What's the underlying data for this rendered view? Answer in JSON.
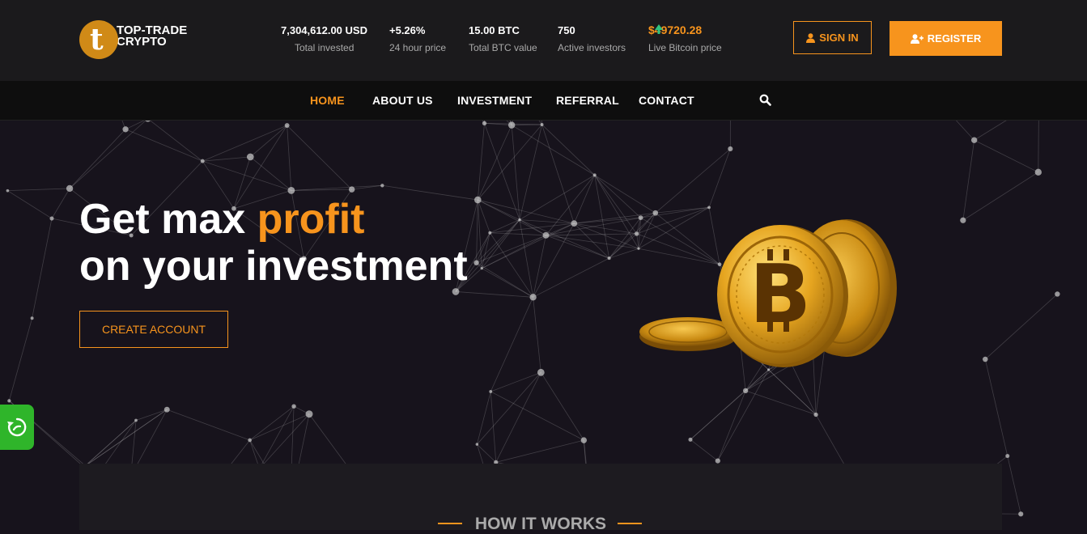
{
  "brand": {
    "line1": "TOP-TRADE",
    "line2": "CRYPTO",
    "logo_letter": "t"
  },
  "stats": [
    {
      "value": "7,304,612.00 USD",
      "label": "Total invested"
    },
    {
      "value": "+5.26%",
      "label": "24 hour price"
    },
    {
      "value": "15.00 BTC",
      "label": "Total BTC value"
    },
    {
      "value": "750",
      "label": "Active investors"
    },
    {
      "value": "$49720.28",
      "label": "Live Bitcoin price"
    }
  ],
  "auth": {
    "signin_label": "SIGN IN",
    "register_label": "REGISTER"
  },
  "nav": {
    "items": [
      "HOME",
      "ABOUT US",
      "INVESTMENT",
      "REFERRAL",
      "CONTACT"
    ],
    "active": "HOME"
  },
  "hero": {
    "line1_plain": "Get max ",
    "line1_accent": "profit",
    "line2": "on your investment",
    "cta_label": "CREATE ACCOUNT"
  },
  "how_it_works": {
    "title": "HOW IT WORKS"
  },
  "colors": {
    "accent": "#f7941d",
    "top_bg": "#1b1a1c",
    "nav_bg": "#0e0e0e",
    "hero_bg": "#17131c",
    "widget": "#2fb52a"
  },
  "icons": [
    "user-icon",
    "user-plus-icon",
    "search-icon",
    "bitcoin-coins-image",
    "chat-widget-icon",
    "price-up-arrow-icon"
  ]
}
